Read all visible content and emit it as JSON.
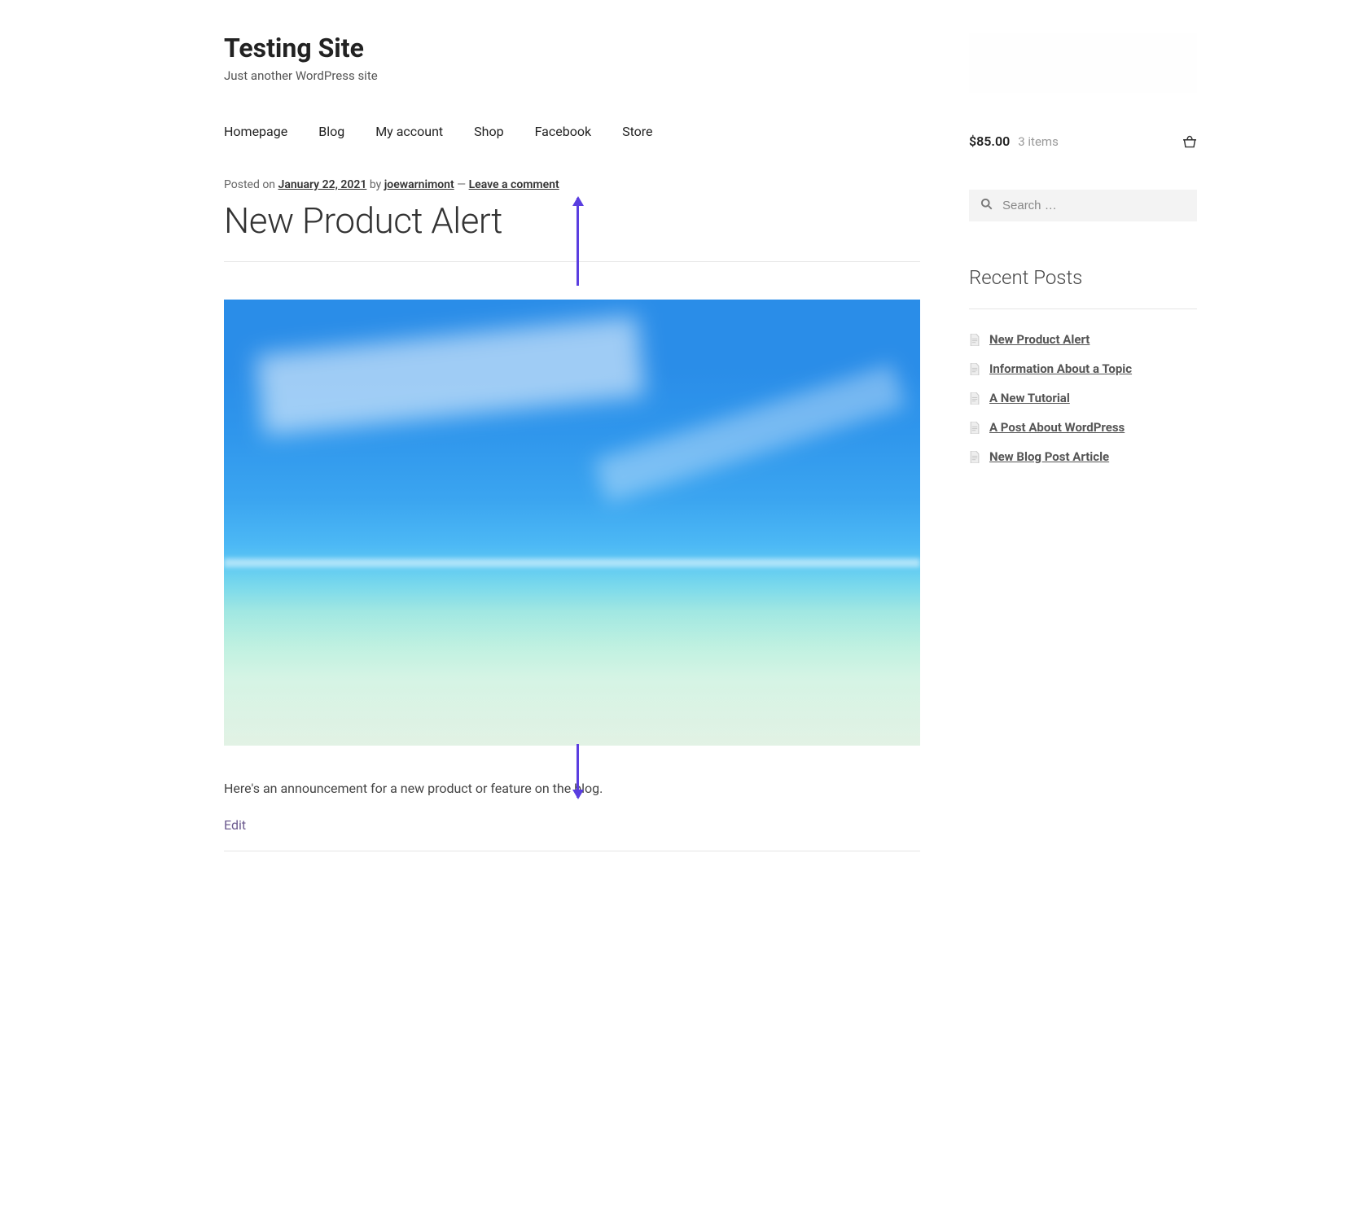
{
  "site": {
    "title": "Testing Site",
    "tagline": "Just another WordPress site"
  },
  "nav": {
    "items": [
      {
        "label": "Homepage"
      },
      {
        "label": "Blog"
      },
      {
        "label": "My account"
      },
      {
        "label": "Shop"
      },
      {
        "label": "Facebook"
      },
      {
        "label": "Store"
      }
    ]
  },
  "cart": {
    "amount": "$85.00",
    "items_text": "3 items"
  },
  "search": {
    "placeholder": "Search …"
  },
  "post": {
    "meta": {
      "posted_on_label": "Posted on ",
      "date": "January 22, 2021",
      "by_label": " by ",
      "author": "joewarnimont",
      "dash": " — ",
      "comment_link": "Leave a comment"
    },
    "title": "New Product Alert",
    "body": "Here's an announcement for a new product or feature on the blog.",
    "edit_label": "Edit"
  },
  "sidebar_widgets": {
    "recent_title": "Recent Posts",
    "recent_items": [
      {
        "label": "New Product Alert"
      },
      {
        "label": "Information About a Topic"
      },
      {
        "label": "A New Tutorial"
      },
      {
        "label": "A Post About WordPress"
      },
      {
        "label": "New Blog Post Article"
      }
    ]
  }
}
